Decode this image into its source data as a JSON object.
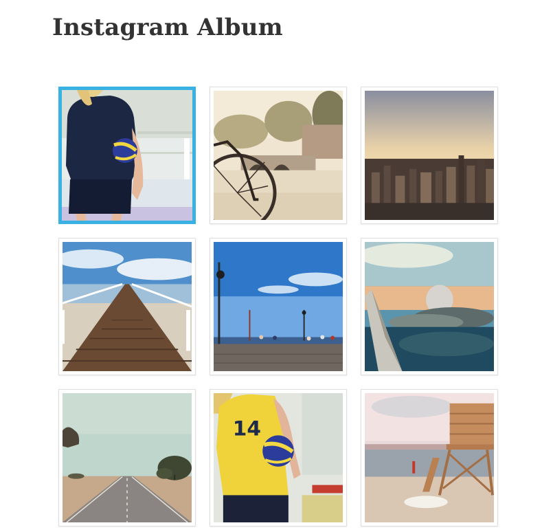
{
  "page": {
    "title": "Instagram Album"
  },
  "colors": {
    "selected_border": "#39b1e3",
    "tile_border": "#dedede",
    "title": "#333333"
  },
  "album": {
    "selected_index": 0,
    "photos": [
      {
        "subject": "volleyball-player-navy"
      },
      {
        "subject": "bicycle-canal-bridge"
      },
      {
        "subject": "city-skyline-sunset"
      },
      {
        "subject": "wooden-pier-ocean"
      },
      {
        "subject": "boardwalk-lamp-posts"
      },
      {
        "subject": "airplane-wing-clouds"
      },
      {
        "subject": "desert-road"
      },
      {
        "subject": "volleyball-player-yellow"
      },
      {
        "subject": "lifeguard-tower-beach"
      }
    ]
  }
}
